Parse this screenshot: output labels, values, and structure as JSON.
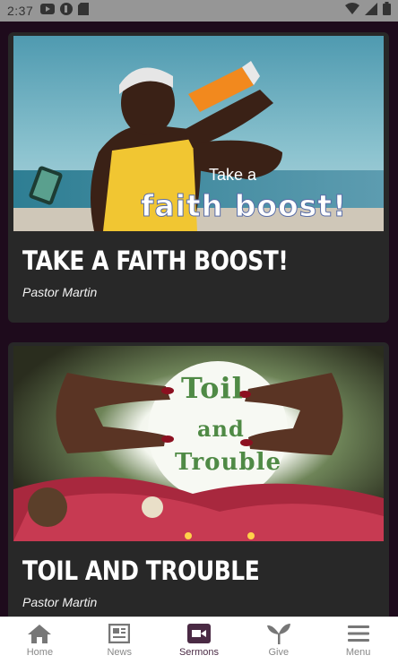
{
  "status_bar": {
    "time": "2:37"
  },
  "sermons": [
    {
      "title": "TAKE A FAITH BOOST!",
      "author": "Pastor Martin",
      "image_small_text": "Take a",
      "image_big_text": "faith boost!"
    },
    {
      "title": "TOIL AND TROUBLE",
      "author": "Pastor Martin",
      "image_line1": "Toil",
      "image_line2": "and",
      "image_line3": "Trouble"
    }
  ],
  "nav": {
    "home": "Home",
    "news": "News",
    "sermons": "Sermons",
    "give": "Give",
    "menu": "Menu",
    "active": "sermons"
  },
  "colors": {
    "active_nav": "#4a2a44",
    "card_bg": "#282828",
    "page_bg": "#1e0b1c"
  }
}
